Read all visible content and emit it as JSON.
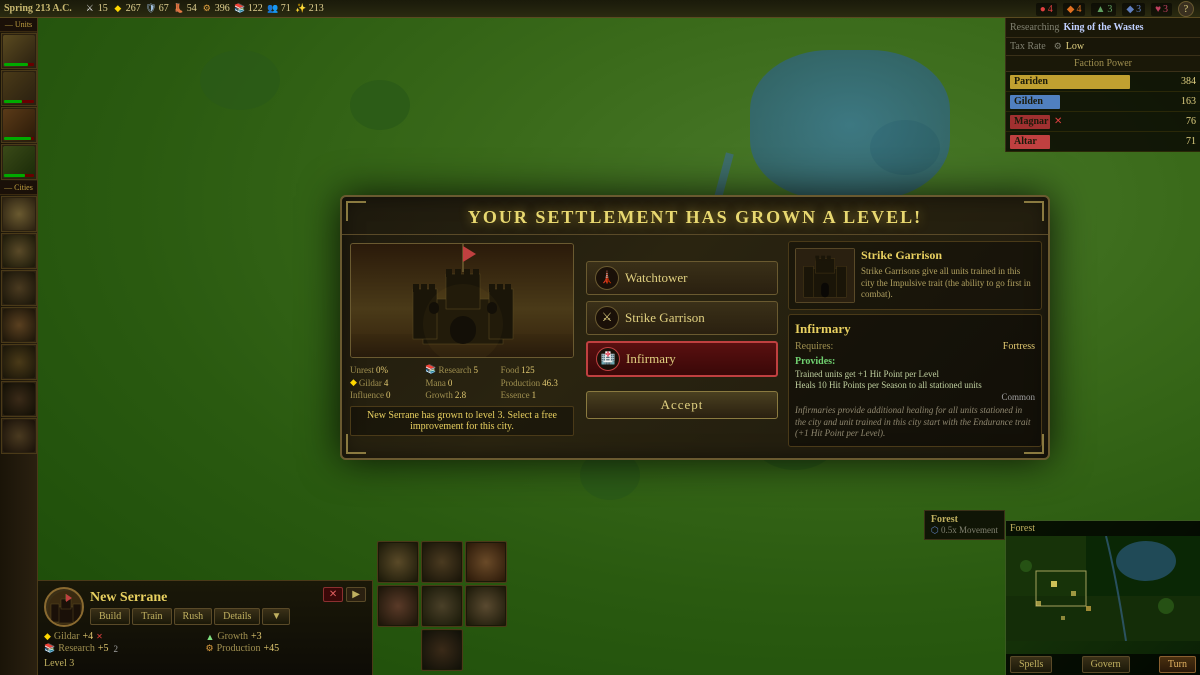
{
  "season": "Spring 213 A.C.",
  "topHud": {
    "stats": [
      {
        "icon": "⚔",
        "value": "15",
        "type": "sword"
      },
      {
        "icon": "💰",
        "value": "267",
        "type": "gold"
      },
      {
        "icon": "🛡",
        "value": "67",
        "type": "shield"
      },
      {
        "icon": "👢",
        "value": "54",
        "type": "boot"
      },
      {
        "icon": "⚙",
        "value": "396",
        "type": "prod"
      },
      {
        "icon": "📚",
        "value": "122",
        "type": "research"
      },
      {
        "icon": "👥",
        "value": "71",
        "type": "pop"
      },
      {
        "icon": "✨",
        "value": "213",
        "type": "essence"
      }
    ]
  },
  "topRight": {
    "indicators": [
      {
        "value": "4",
        "color": "#e04040"
      },
      {
        "value": "4",
        "color": "#e07020"
      },
      {
        "value": "3",
        "color": "#60a060"
      },
      {
        "value": "3",
        "color": "#6080c0"
      },
      {
        "value": "3",
        "color": "#c04060"
      },
      {
        "value": "?",
        "color": "#808080"
      }
    ]
  },
  "research": {
    "label": "Researching",
    "value": "King of the Wastes"
  },
  "taxRate": {
    "label": "Tax Rate",
    "value": "Low"
  },
  "factionPower": {
    "header": "Faction Power",
    "factions": [
      {
        "name": "Pariden",
        "score": "384",
        "color": "#c0a030"
      },
      {
        "name": "Gilden",
        "score": "163",
        "color": "#5080c0"
      },
      {
        "name": "Magnar",
        "score": "76",
        "color": "#a03030",
        "eliminated": true
      },
      {
        "name": "Altar",
        "score": "71",
        "color": "#c04040"
      }
    ]
  },
  "dialog": {
    "title": "Your settlement has grown a level!",
    "buildings": [
      {
        "id": "watchtower",
        "name": "Watchtower",
        "icon": "🗼",
        "selected": false
      },
      {
        "id": "strike-garrison",
        "name": "Strike Garrison",
        "icon": "⚔",
        "selected": false
      },
      {
        "id": "infirmary",
        "name": "Infirmary",
        "icon": "🏥",
        "selected": true
      }
    ],
    "selectedPreview": {
      "name": "Strike Garrison",
      "description": "Strike Garrisons give all units trained in this city the Impulsive trait (the ability to go first in combat)."
    },
    "detailPanel": {
      "name": "Infirmary",
      "requires": "Fortress",
      "providesLabel": "Provides:",
      "provides": [
        "Trained units get +1 Hit Point per Level",
        "Heals 10 Hit Points per Season to all stationed units"
      ],
      "commonLabel": "Common",
      "flavorText": "Infirmaries provide additional healing for all units stationed in the city and unit trained in this city start with the Endurance trait (+1 Hit Point per Level)."
    },
    "message": "New Serrane has grown to level 3. Select a free improvement for this city.",
    "acceptButton": "Accept"
  },
  "cityPanel": {
    "name": "New Serrane",
    "level": "Level 3",
    "resources": [
      {
        "name": "Gildar",
        "value": "+4"
      },
      {
        "name": "Growth",
        "value": "+3"
      },
      {
        "name": "Research",
        "value": "+5"
      },
      {
        "name": "Production",
        "value": "+45"
      }
    ],
    "actions": [
      "Build",
      "Train",
      "Rush",
      "Details"
    ]
  },
  "minimap": {
    "header": "Forest",
    "subtext": "0.5x Movement",
    "buttons": [
      "Spells",
      "Govern",
      "Turn"
    ]
  },
  "sidebar": {
    "sections": [
      {
        "label": "— Units"
      },
      {
        "label": "— Cities"
      }
    ]
  }
}
